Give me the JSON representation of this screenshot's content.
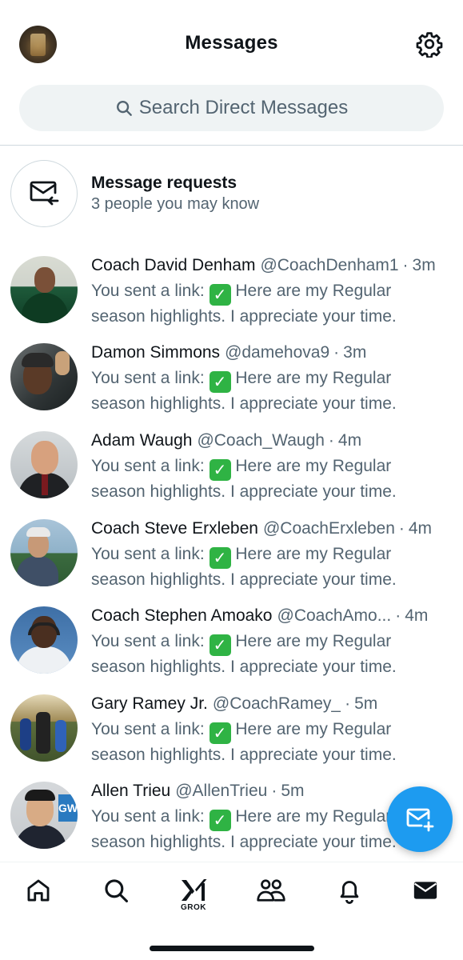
{
  "header": {
    "title": "Messages"
  },
  "search": {
    "placeholder": "Search Direct Messages"
  },
  "requests": {
    "title": "Message requests",
    "subtitle": "3 people you may know"
  },
  "conversations": [
    {
      "name": "Coach David Denham",
      "handle": "@CoachDenham1",
      "time": "3m",
      "snippet_prefix": "You sent a link:",
      "snippet_text": "Here are my Regular season highlights. I appreciate your time."
    },
    {
      "name": "Damon Simmons",
      "handle": "@damehova9",
      "time": "3m",
      "snippet_prefix": "You sent a link:",
      "snippet_text": "Here are my Regular season highlights. I appreciate your time."
    },
    {
      "name": "Adam Waugh",
      "handle": "@Coach_Waugh",
      "time": "4m",
      "snippet_prefix": "You sent a link:",
      "snippet_text": "Here are my Regular season highlights. I appreciate your time."
    },
    {
      "name": "Coach Steve Erxleben",
      "handle": "@CoachErxleben",
      "time": "4m",
      "snippet_prefix": "You sent a link:",
      "snippet_text": "Here are my Regular season highlights. I appreciate your time."
    },
    {
      "name": "Coach Stephen Amoako",
      "handle": "@CoachAmo...",
      "time": "4m",
      "snippet_prefix": "You sent a link:",
      "snippet_text": "Here are my Regular season highlights. I appreciate your time."
    },
    {
      "name": "Gary Ramey Jr.",
      "handle": "@CoachRamey_",
      "time": "5m",
      "snippet_prefix": "You sent a link:",
      "snippet_text": "Here are my Regular season highlights. I appreciate your time."
    },
    {
      "name": "Allen Trieu",
      "handle": "@AllenTrieu",
      "time": "5m",
      "snippet_prefix": "You sent a link:",
      "snippet_text": "Here are my Regular season highlights. I appreciate your time."
    }
  ],
  "check_glyph": "✓",
  "separator": "·",
  "avatar_7_sign": "GW",
  "nav": {
    "items": [
      "home-icon",
      "search-icon",
      "grok-icon",
      "communities-icon",
      "notifications-icon",
      "messages-icon"
    ],
    "grok_label": "GROK"
  },
  "colors": {
    "accent": "#1d9bf0",
    "text_primary": "#0f1419",
    "text_secondary": "#536471",
    "check_green": "#2fb344"
  }
}
